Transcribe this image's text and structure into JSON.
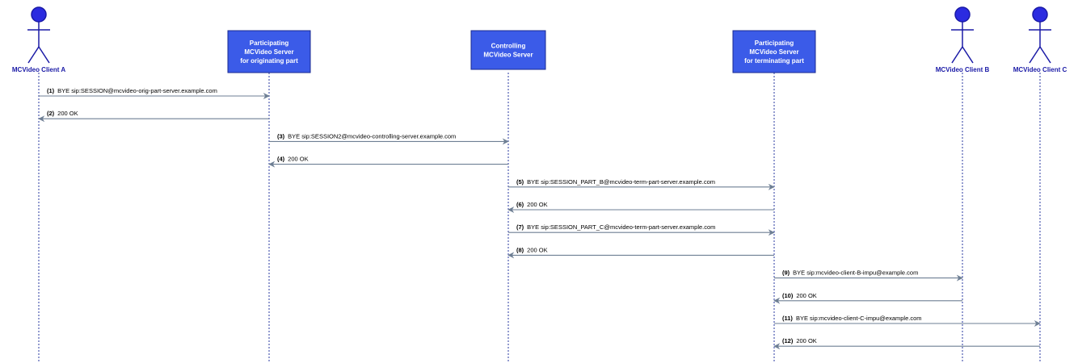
{
  "participants": [
    {
      "id": "client_a",
      "kind": "actor",
      "lines": [
        "MCVideo Client A"
      ]
    },
    {
      "id": "orig_server",
      "kind": "box",
      "lines": [
        "Participating",
        "MCVideo Server",
        "for originating part"
      ]
    },
    {
      "id": "ctrl_server",
      "kind": "box",
      "lines": [
        "Controlling",
        "MCVideo Server"
      ]
    },
    {
      "id": "term_server",
      "kind": "box",
      "lines": [
        "Participating",
        "MCVideo Server",
        "for terminating part"
      ]
    },
    {
      "id": "client_b",
      "kind": "actor",
      "lines": [
        "MCVideo Client B"
      ]
    },
    {
      "id": "client_c",
      "kind": "actor",
      "lines": [
        "MCVideo Client C"
      ]
    }
  ],
  "messages": [
    {
      "num": "(1)",
      "text": "BYE sip:SESSION@mcvideo-orig-part-server.example.com",
      "from": "client_a",
      "to": "orig_server"
    },
    {
      "num": "(2)",
      "text": "200 OK",
      "from": "orig_server",
      "to": "client_a"
    },
    {
      "num": "(3)",
      "text": "BYE sip:SESSION2@mcvideo-controlling-server.example.com",
      "from": "orig_server",
      "to": "ctrl_server"
    },
    {
      "num": "(4)",
      "text": "200 OK",
      "from": "ctrl_server",
      "to": "orig_server"
    },
    {
      "num": "(5)",
      "text": "BYE sip:SESSION_PART_B@mcvideo-term-part-server.example.com",
      "from": "ctrl_server",
      "to": "term_server"
    },
    {
      "num": "(6)",
      "text": "200 OK",
      "from": "term_server",
      "to": "ctrl_server"
    },
    {
      "num": "(7)",
      "text": "BYE sip:SESSION_PART_C@mcvideo-term-part-server.example.com",
      "from": "ctrl_server",
      "to": "term_server"
    },
    {
      "num": "(8)",
      "text": "200 OK",
      "from": "term_server",
      "to": "ctrl_server"
    },
    {
      "num": "(9)",
      "text": "BYE sip:mcvideo-client-B-impu@example.com",
      "from": "term_server",
      "to": "client_b"
    },
    {
      "num": "(10)",
      "text": "200 OK",
      "from": "client_b",
      "to": "term_server"
    },
    {
      "num": "(11)",
      "text": "BYE sip:mcvideo-client-C-impu@example.com",
      "from": "term_server",
      "to": "client_c"
    },
    {
      "num": "(12)",
      "text": "200 OK",
      "from": "client_c",
      "to": "term_server"
    }
  ],
  "colors": {
    "actor_fill": "#2b2be0",
    "actor_stroke": "#1a1aa6",
    "box_fill": "#3b5be8",
    "box_stroke": "#1a2a90",
    "lifeline": "#2a3aa0",
    "arrow": "#6e7f94"
  }
}
